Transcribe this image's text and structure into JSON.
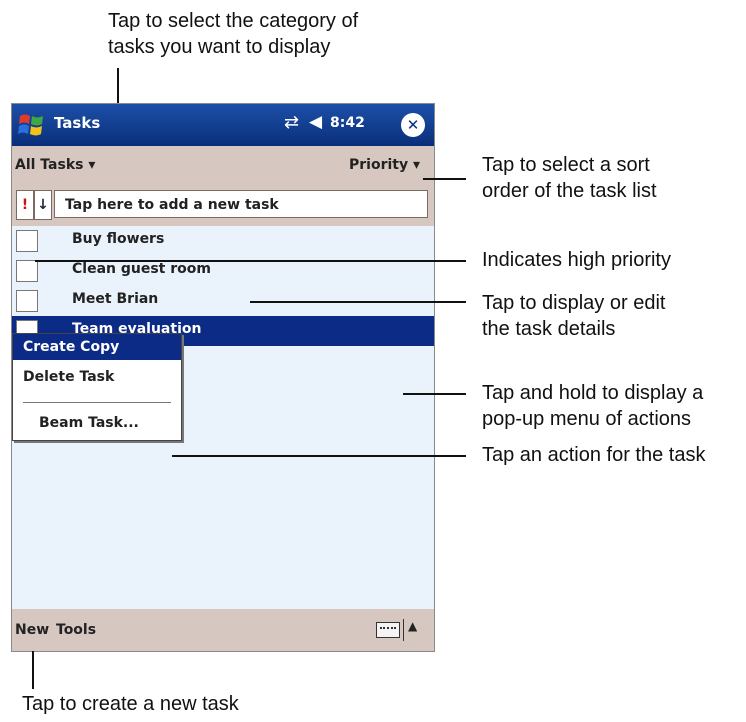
{
  "callouts": {
    "category_line1": "Tap to select the category of",
    "category_line2": "tasks you want to display",
    "sort_line1": "Tap to select a sort",
    "sort_line2": "order of the task list",
    "priority": "Indicates high priority",
    "details_line1": "Tap to display or edit",
    "details_line2": "the task details",
    "hold_line1": "Tap and hold to display a",
    "hold_line2": "pop-up menu of actions",
    "action": "Tap an action for the task",
    "new_task": "Tap to create a new task"
  },
  "titlebar": {
    "title": "Tasks",
    "time": "8:42",
    "icons": [
      "windows-start-icon",
      "connectivity-icon",
      "speaker-icon",
      "close-icon"
    ]
  },
  "toolbar": {
    "category": "All Tasks",
    "sort": "Priority"
  },
  "entry": {
    "priority_symbol": "!",
    "sort_symbol": "↓",
    "placeholder": "Tap here to add a new task"
  },
  "tasks": [
    {
      "name": "Buy flowers"
    },
    {
      "name": "Clean guest room"
    },
    {
      "name": "Meet Brian"
    },
    {
      "name": "Team evaluation"
    }
  ],
  "context_menu": {
    "items": [
      "Create Copy",
      "Delete Task",
      "Beam Task..."
    ]
  },
  "bottom_bar": {
    "new_label": "New",
    "tools_label": "Tools"
  },
  "colors": {
    "titlebar": "#0a2f7a",
    "selection": "#0c2b86",
    "bars": "#d6c8c0",
    "list_bg": "#eaf2fb"
  }
}
